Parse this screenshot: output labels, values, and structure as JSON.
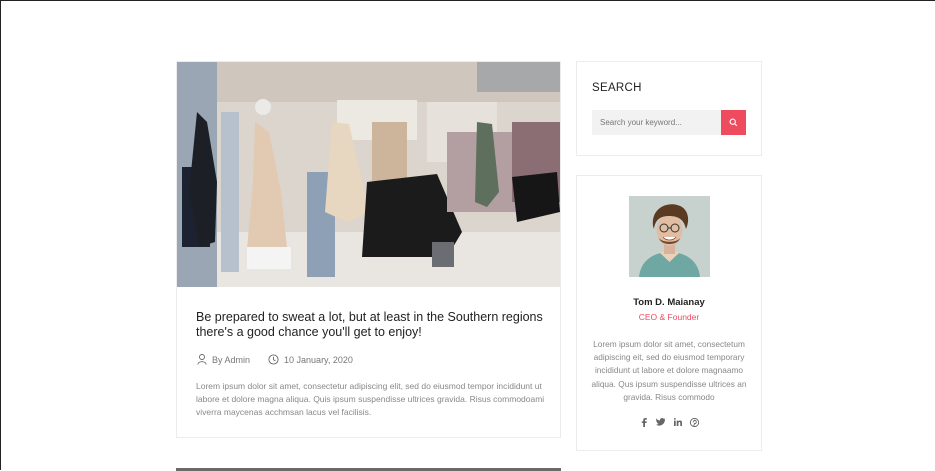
{
  "post": {
    "title": "Be prepared to sweat a lot, but at least in the Southern regions there's a good chance you'll get to enjoy!",
    "author": "By Admin",
    "date": "10 January, 2020",
    "excerpt": "Lorem ipsum dolor sit amet, consectetur adipiscing elit, sed do eiusmod tempor incididunt ut labore et dolore magna aliqua. Quis ipsum suspendisse ultrices gravida. Risus commodoami viverra maycenas acchmsan lacus vel facilisis."
  },
  "search": {
    "title": "SEARCH",
    "placeholder": "Search your keyword..."
  },
  "author_widget": {
    "name": "Tom D. Maianay",
    "role": "CEO & Founder",
    "bio": "Lorem ipsum dolor sit amet, consectetum adipiscing eit, sed do eiusmod temporary incididunt ut labore et dolore magnaamo aliqua. Qus ipsum suspendisse ultrices an gravida. Risus commodo",
    "social": [
      "facebook-icon",
      "twitter-icon",
      "linkedin-icon",
      "pinterest-icon"
    ]
  },
  "colors": {
    "accent": "#ef4b5f"
  }
}
